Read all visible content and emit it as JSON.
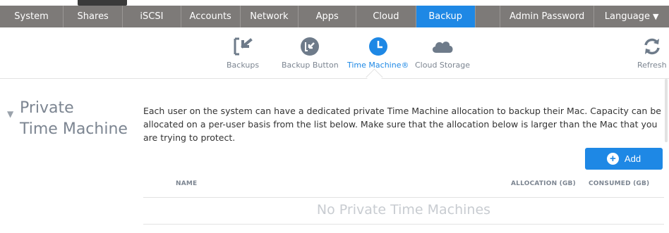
{
  "nav": {
    "tabs": [
      {
        "label": "System",
        "w": 92
      },
      {
        "label": "Shares",
        "w": 86
      },
      {
        "label": "iSCSI",
        "w": 84
      },
      {
        "label": "Accounts",
        "w": 86
      },
      {
        "label": "Network",
        "w": 84
      },
      {
        "label": "Apps",
        "w": 84
      },
      {
        "label": "Cloud",
        "w": 86
      },
      {
        "label": "Backup",
        "w": 86
      },
      {
        "label": "",
        "w": 36
      },
      {
        "label": "Admin Password",
        "w": 136
      },
      {
        "label": "Language",
        "w": 108
      }
    ],
    "active_index": 7,
    "language_caret": "▼"
  },
  "subnav": {
    "items": [
      {
        "label": "Backups",
        "icon": "backups-arrow-icon"
      },
      {
        "label": "Backup Button",
        "icon": "backup-button-icon"
      },
      {
        "label": "Time Machine®",
        "icon": "time-machine-clock-icon"
      },
      {
        "label": "Cloud Storage",
        "icon": "cloud-icon"
      }
    ],
    "active_index": 2,
    "refresh_label": "Refresh"
  },
  "section": {
    "title_line1": "Private",
    "title_line2": "Time Machine",
    "description": "Each user on the system can have a dedicated private Time Machine allocation to backup their Mac. Capacity can be allocated on a per-user basis from the list below. Make sure that the allocation below is larger than the Mac that you are trying to protect.",
    "add_label": "Add"
  },
  "table": {
    "columns": {
      "name": "NAME",
      "allocation": "ALLOCATION (GB)",
      "consumed": "CONSUMED (GB)"
    },
    "empty_text": "No Private Time Machines"
  },
  "colors": {
    "accent": "#1e88e5",
    "nav_bg": "#7d7a78",
    "muted_text": "#7c8591"
  }
}
